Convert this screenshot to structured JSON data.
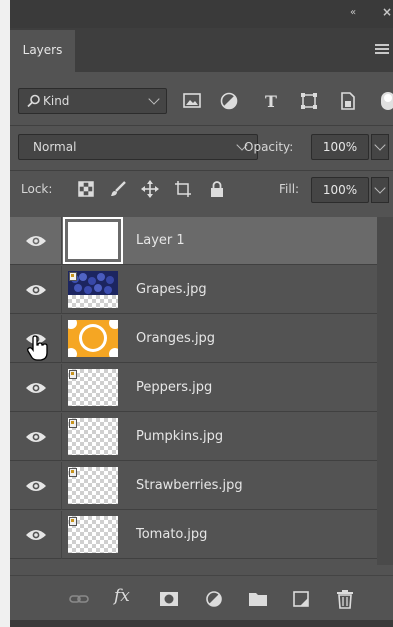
{
  "window": {
    "collapse_label": "«",
    "close_label": "×"
  },
  "tabs": [
    {
      "label": "Layers",
      "active": true
    }
  ],
  "filter": {
    "kind_label": "Kind",
    "icons": [
      "image-filter-icon",
      "adjustment-filter-icon",
      "type-filter-icon",
      "shape-filter-icon",
      "smart-object-filter-icon",
      "filter-toggle-icon"
    ]
  },
  "blend": {
    "mode": "Normal",
    "opacity_label": "Opacity:",
    "opacity_value": "100%"
  },
  "lock": {
    "label": "Lock:",
    "fill_label": "Fill:",
    "fill_value": "100%",
    "icons": [
      "lock-transparent-pixels-icon",
      "lock-image-pixels-icon",
      "lock-position-icon",
      "lock-artboard-icon",
      "lock-all-icon"
    ]
  },
  "layers": [
    {
      "name": "Layer 1",
      "thumb": "white",
      "selected": true,
      "visible": true
    },
    {
      "name": "Grapes.jpg",
      "thumb": "grapes",
      "selected": false,
      "visible": true
    },
    {
      "name": "Oranges.jpg",
      "thumb": "oranges",
      "selected": false,
      "visible": true
    },
    {
      "name": "Peppers.jpg",
      "thumb": "transparent",
      "selected": false,
      "visible": true
    },
    {
      "name": "Pumpkins.jpg",
      "thumb": "transparent",
      "selected": false,
      "visible": true
    },
    {
      "name": "Strawberries.jpg",
      "thumb": "transparent",
      "selected": false,
      "visible": true
    },
    {
      "name": "Tomato.jpg",
      "thumb": "transparent",
      "selected": false,
      "visible": true
    }
  ],
  "footer": {
    "icons": [
      "link-layers-icon",
      "fx-icon",
      "layer-mask-icon",
      "adjustment-layer-icon",
      "group-folder-icon",
      "new-layer-icon",
      "trash-icon"
    ],
    "fx_label": "fx"
  },
  "colors": {
    "panel": "#535353",
    "selected_row": "#6a6a6a",
    "orange": "#f5a623",
    "grape": "#2a3a8c"
  }
}
